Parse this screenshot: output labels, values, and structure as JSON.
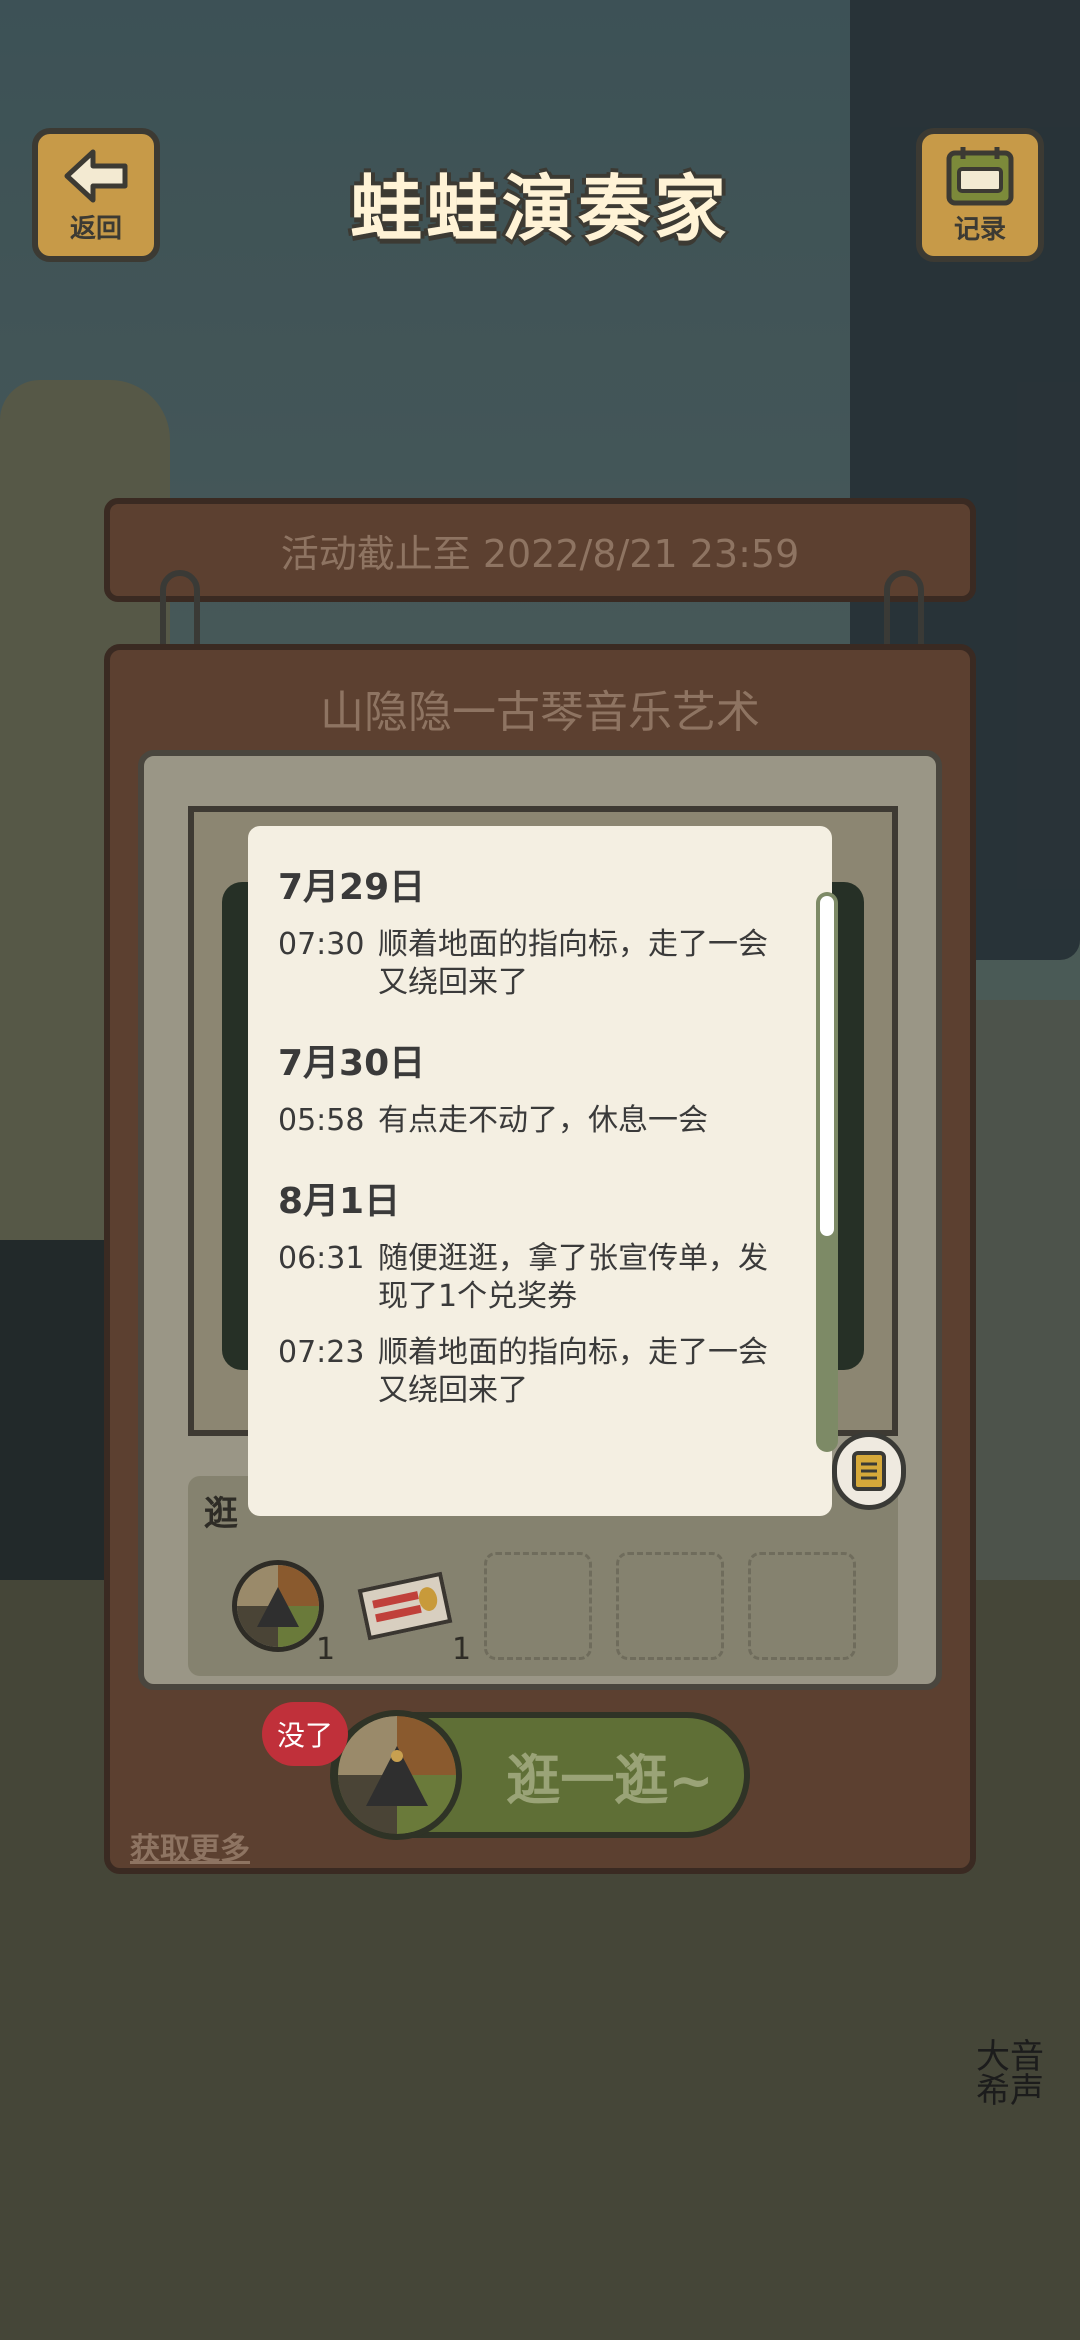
{
  "header": {
    "back_label": "返回",
    "title": "蛙蛙演奏家",
    "record_label": "记录"
  },
  "event": {
    "deadline": "活动截止至 2022/8/21 23:59",
    "name": "山隐隐一古琴音乐艺术"
  },
  "log": [
    {
      "date": "7月29日",
      "entries": [
        {
          "time": "07:30",
          "text": "顺着地面的指向标，走了一会又绕回来了"
        }
      ]
    },
    {
      "date": "7月30日",
      "entries": [
        {
          "time": "05:58",
          "text": "有点走不动了，休息一会"
        }
      ]
    },
    {
      "date": "8月1日",
      "entries": [
        {
          "time": "06:31",
          "text": "随便逛逛，拿了张宣传单，发现了1个兑奖券"
        },
        {
          "time": "07:23",
          "text": "顺着地面的指向标，走了一会又绕回来了"
        }
      ]
    }
  ],
  "items": {
    "label": "逛",
    "compass_count": "1",
    "ticket_count": "1"
  },
  "actions": {
    "get_more": "获取更多",
    "go_label": "逛一逛~",
    "empty_badge": "没了"
  },
  "watermark": "大音希声"
}
